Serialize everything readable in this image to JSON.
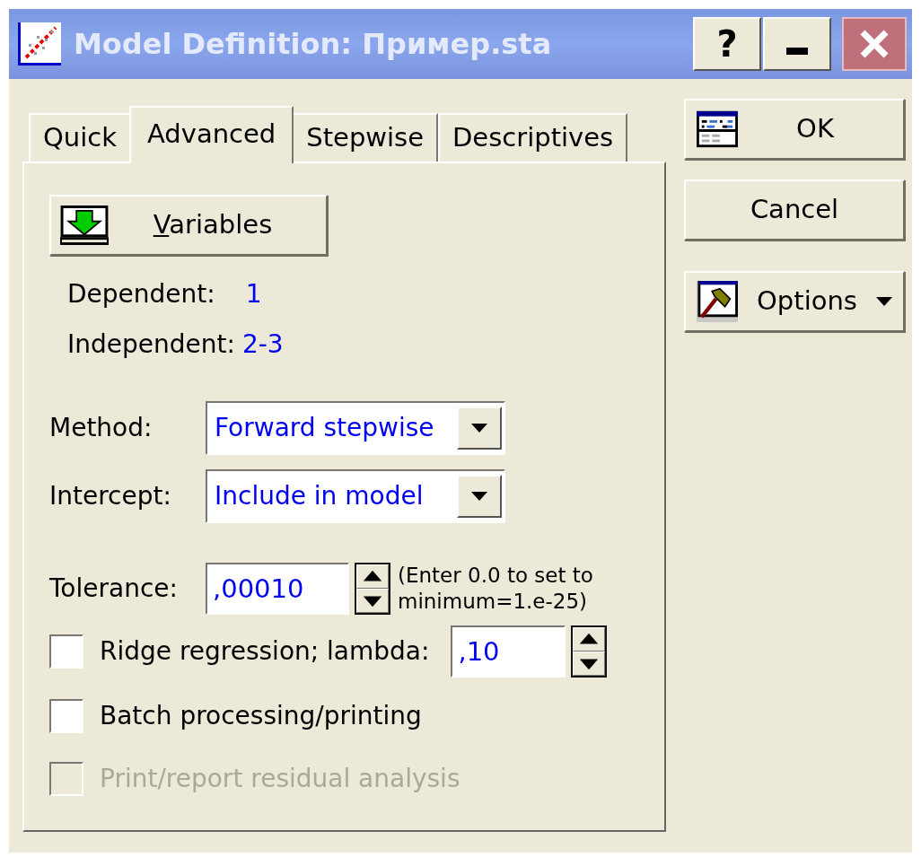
{
  "window": {
    "title": "Model Definition: Пример.sta",
    "help_glyph": "?"
  },
  "tabs": [
    {
      "label": "Quick",
      "selected": false
    },
    {
      "label": "Advanced",
      "selected": true
    },
    {
      "label": "Stepwise",
      "selected": false
    },
    {
      "label": "Descriptives",
      "selected": false
    }
  ],
  "variables_button": {
    "label": "Variables"
  },
  "variables": [
    {
      "label": "Dependent:",
      "value": "1"
    },
    {
      "label": "Independent:",
      "value": "2-3"
    }
  ],
  "dropdowns": [
    {
      "label": "Method:",
      "value": "Forward stepwise"
    },
    {
      "label": "Intercept:",
      "value": "Include in model"
    }
  ],
  "tolerance": {
    "label": "Tolerance:",
    "value": ",00010",
    "hint": "(Enter 0.0 to set to minimum=1.e-25)"
  },
  "options": [
    {
      "kind": "checkbox_field",
      "label": "Ridge regression; lambda:",
      "checked": false,
      "disabled": false,
      "value": ",10"
    },
    {
      "kind": "checkbox",
      "label": "Batch processing/printing",
      "checked": false,
      "disabled": false
    },
    {
      "kind": "checkbox",
      "label": "Print/report residual analysis",
      "checked": false,
      "disabled": true
    }
  ],
  "buttons": [
    {
      "label": "OK",
      "kind": "confirm"
    },
    {
      "label": "Cancel",
      "kind": "plain"
    },
    {
      "label": "Options",
      "kind": "menu"
    }
  ]
}
